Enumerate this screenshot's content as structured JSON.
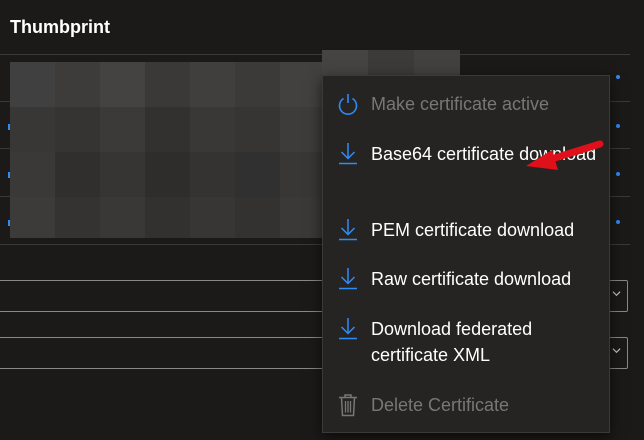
{
  "header": {
    "title": "Thumbprint"
  },
  "menu": {
    "items": [
      {
        "label": "Make certificate active",
        "icon": "power-icon",
        "disabled": true
      },
      {
        "label": "Base64 certificate download",
        "icon": "download-icon",
        "disabled": false
      },
      {
        "label": "PEM certificate download",
        "icon": "download-icon",
        "disabled": false
      },
      {
        "label": "Raw certificate download",
        "icon": "download-icon",
        "disabled": false
      },
      {
        "label": "Download federated certificate XML",
        "icon": "download-icon",
        "disabled": false
      },
      {
        "label": "Delete Certificate",
        "icon": "trash-icon",
        "disabled": true
      }
    ]
  },
  "colors": {
    "background": "#1b1a19",
    "menu_background": "#252423",
    "accent": "#2f8cf5",
    "disabled_text": "#797775",
    "annotation_arrow": "#e0101a"
  }
}
